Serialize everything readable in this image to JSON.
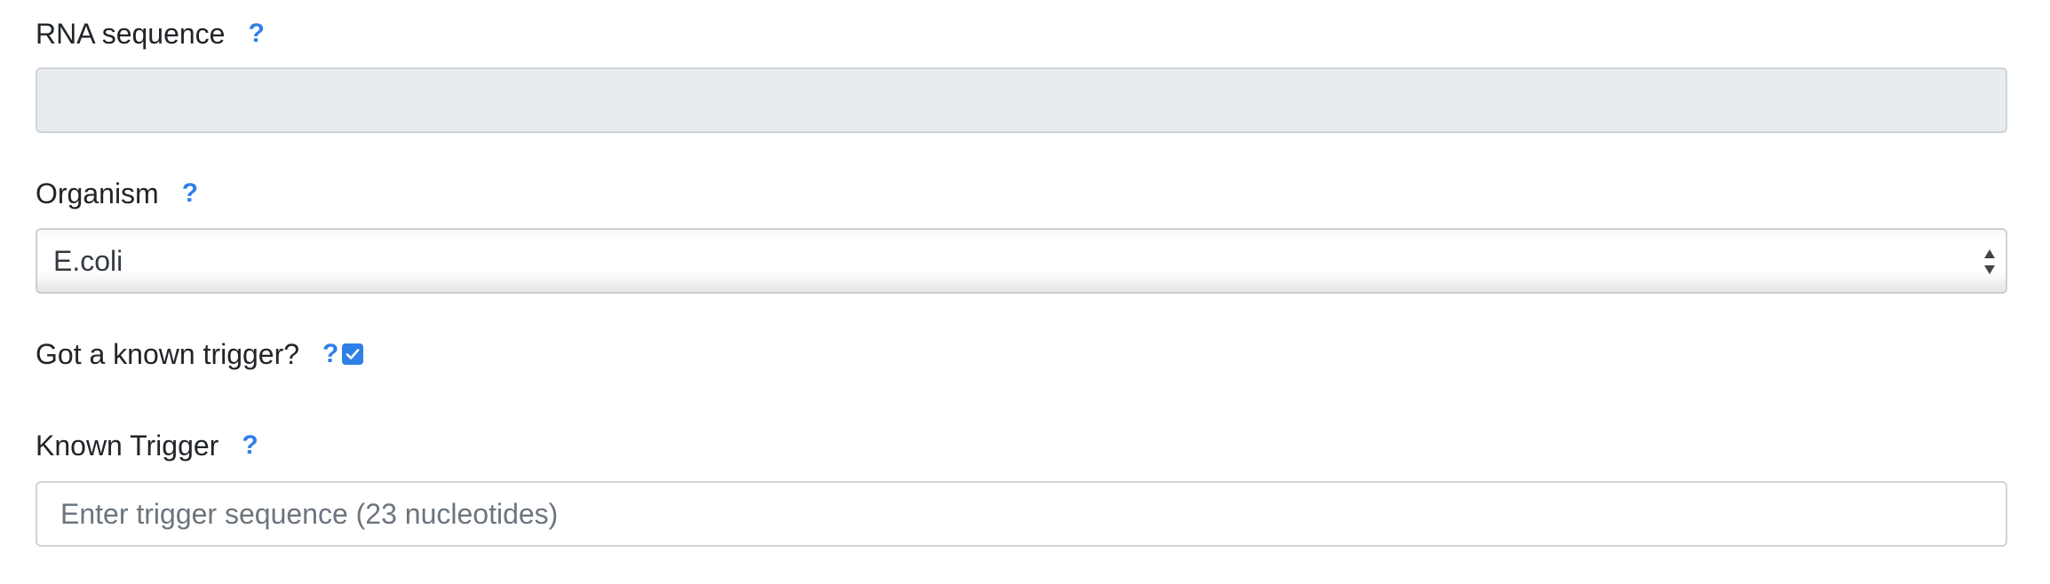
{
  "rna_sequence": {
    "label": "RNA sequence",
    "help": "?",
    "value": ""
  },
  "organism": {
    "label": "Organism",
    "help": "?",
    "selected": "E.coli"
  },
  "known_trigger_toggle": {
    "label": "Got a known trigger?",
    "help": "?",
    "checked": true
  },
  "known_trigger": {
    "label": "Known Trigger",
    "help": "?",
    "placeholder": "Enter trigger sequence (23 nucleotides)",
    "value": ""
  },
  "colors": {
    "help_icon": "#2f7fe8",
    "checkbox": "#2f7fe8",
    "readonly_field": "#e9ecef"
  }
}
